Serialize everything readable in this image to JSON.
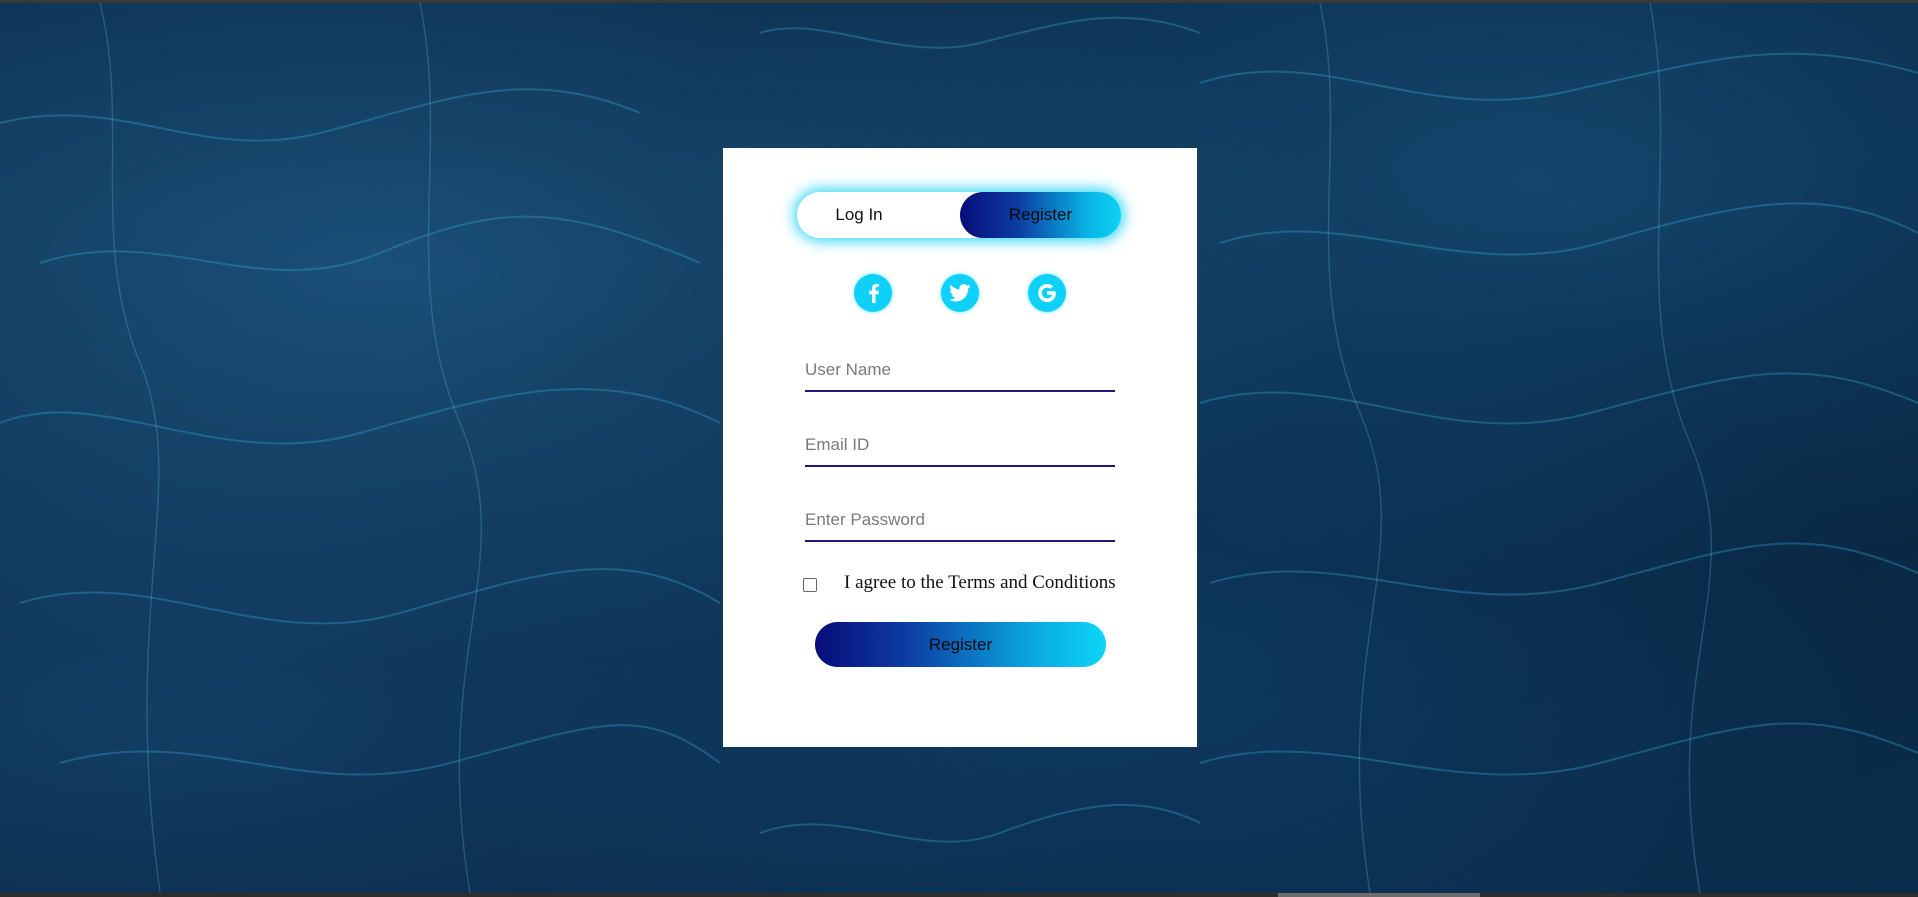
{
  "colors": {
    "accent_cyan": "#0fd0f7",
    "accent_navy": "#070d7a",
    "card_bg": "#ffffff",
    "underline": "#1a1a7a"
  },
  "background": {
    "description_icon": "water-texture"
  },
  "toggle": {
    "login_label": "Log In",
    "register_label": "Register",
    "active": "Register"
  },
  "socials": [
    {
      "name": "facebook",
      "icon": "facebook-icon"
    },
    {
      "name": "twitter",
      "icon": "twitter-icon"
    },
    {
      "name": "google",
      "icon": "google-icon"
    }
  ],
  "form": {
    "username": {
      "placeholder": "User Name",
      "value": ""
    },
    "email": {
      "placeholder": "Email ID",
      "value": ""
    },
    "password": {
      "placeholder": "Enter Password",
      "value": ""
    },
    "agree_label": "I agree to the Terms and Conditions",
    "agree_checked": false,
    "submit_label": "Register"
  }
}
